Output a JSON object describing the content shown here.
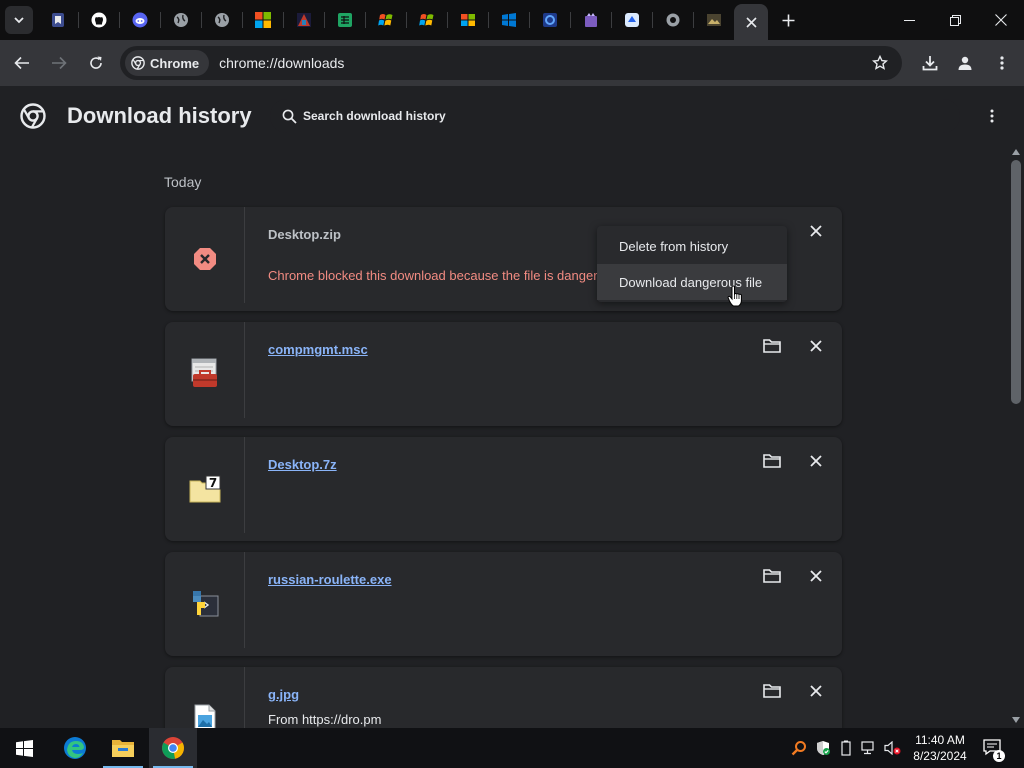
{
  "browser": {
    "tabs": [
      {
        "icon": "bookmark-shield-favicon",
        "color": "#5b74c9",
        "active": false
      },
      {
        "icon": "github-favicon",
        "color": "#ffffff",
        "active": false
      },
      {
        "icon": "discord-favicon",
        "color": "#5865f2",
        "active": false
      },
      {
        "icon": "globe-favicon",
        "color": "#9aa0a6",
        "active": false
      },
      {
        "icon": "globe-favicon",
        "color": "#9aa0a6",
        "active": false
      },
      {
        "icon": "microsoft-favicon",
        "color": "#f25022",
        "active": false
      },
      {
        "icon": "colorful-favicon",
        "color": "#c0392b",
        "active": false
      },
      {
        "icon": "spreadsheet-favicon",
        "color": "#1fa463",
        "active": false
      },
      {
        "icon": "windows-xp-favicon",
        "color": "#f5b400",
        "active": false
      },
      {
        "icon": "windows-xp-favicon",
        "color": "#f5b400",
        "active": false
      },
      {
        "icon": "windows-favicon",
        "color": "#f5b400",
        "active": false
      },
      {
        "icon": "windows-favicon",
        "color": "#0078d4",
        "active": false
      },
      {
        "icon": "circle-app-favicon",
        "color": "#3b82f6",
        "active": false
      },
      {
        "icon": "purple-app-favicon",
        "color": "#8b5cf6",
        "active": false
      },
      {
        "icon": "blue-app-favicon",
        "color": "#3b82f6",
        "active": false
      },
      {
        "icon": "gear-favicon",
        "color": "#9aa0a6",
        "active": false
      },
      {
        "icon": "image-favicon",
        "color": "#8a7a4a",
        "active": false
      },
      {
        "icon": "close-icon",
        "color": "#e8eaed",
        "active": true
      }
    ],
    "omnibox": {
      "chip_label": "Chrome",
      "url": "chrome://downloads"
    }
  },
  "page": {
    "title": "Download history",
    "search_placeholder": "Search download history",
    "section_label": "Today"
  },
  "downloads": [
    {
      "name": "Desktop.zip",
      "status": "Chrome blocked this download because the file is dangerous",
      "state": "dangerous",
      "file_icon": "blocked-icon"
    },
    {
      "name": "compmgmt.msc",
      "state": "complete",
      "file_icon": "toolbox-file-icon"
    },
    {
      "name": "Desktop.7z",
      "state": "complete",
      "file_icon": "7zip-file-icon"
    },
    {
      "name": "russian-roulette.exe",
      "state": "complete",
      "file_icon": "python-file-icon"
    },
    {
      "name": "g.jpg",
      "source": "From https://dro.pm",
      "state": "complete",
      "file_icon": "image-file-icon"
    }
  ],
  "context_menu": {
    "items": [
      {
        "label": "Delete from history",
        "hovered": false
      },
      {
        "label": "Download dangerous file",
        "hovered": true
      }
    ]
  },
  "taskbar": {
    "apps": [
      {
        "icon": "windows-start-icon"
      },
      {
        "icon": "edge-icon"
      },
      {
        "icon": "file-explorer-icon"
      },
      {
        "icon": "chrome-icon"
      }
    ],
    "time": "11:40 AM",
    "date": "8/23/2024",
    "notifications_count": "1"
  },
  "colors": {
    "accent_link": "#8ab4f8",
    "danger": "#f28b82",
    "page_bg": "#202124",
    "card_bg": "#28292c"
  }
}
